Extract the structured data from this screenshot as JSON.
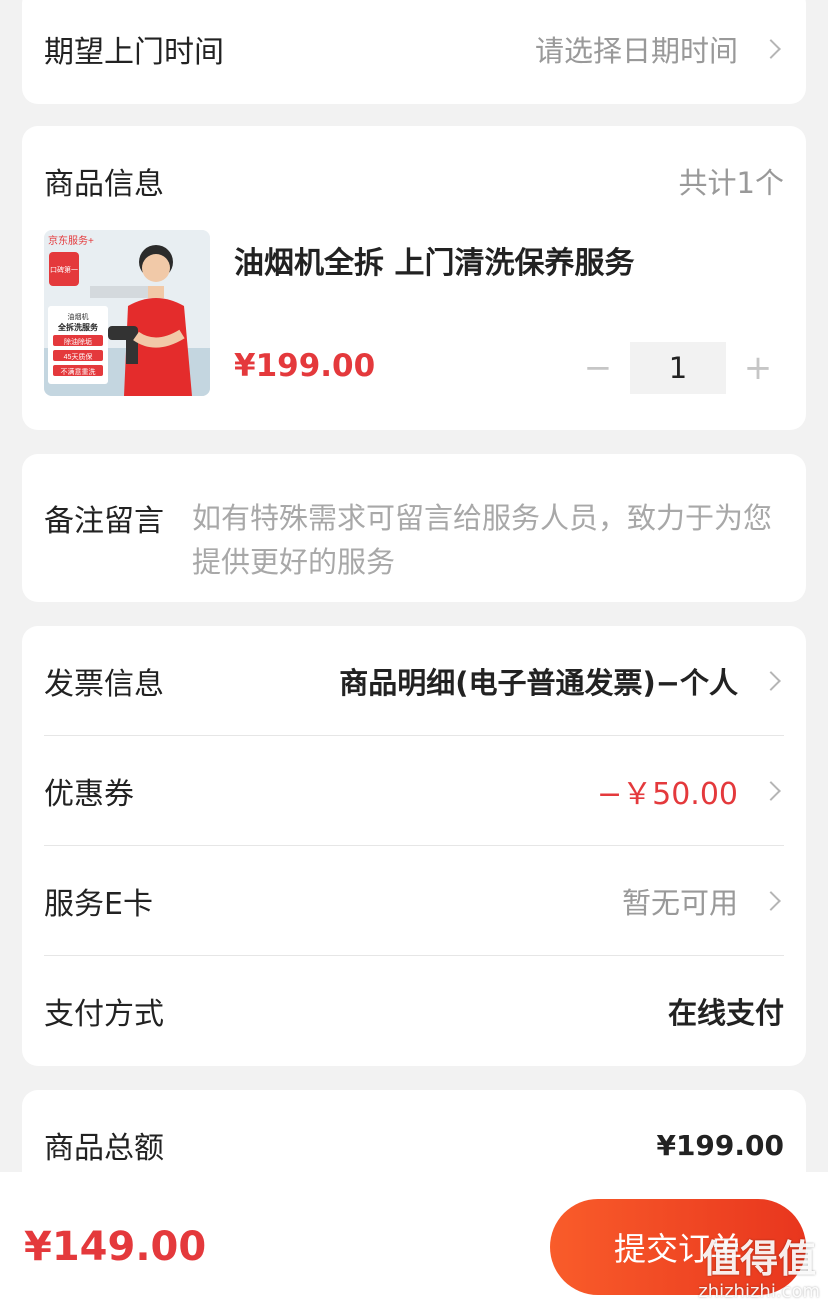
{
  "expected_time": {
    "label": "期望上门时间",
    "placeholder": "请选择日期时间"
  },
  "product_section": {
    "title": "商品信息",
    "count_text": "共计1个",
    "product": {
      "name": "油烟机全拆 上门清洗保养服务",
      "price": "¥199.00",
      "quantity": "1",
      "thumb": {
        "brand_text": "京东服务+",
        "badge_text": "口碑第一",
        "line1": "油烟机",
        "line2": "全拆洗服务",
        "tag1": "除油除垢",
        "tag2": "45天质保",
        "tag3": "不满意重洗"
      }
    },
    "minus_symbol": "−",
    "plus_symbol": "+"
  },
  "remark": {
    "label": "备注留言",
    "placeholder": "如有特殊需求可留言给服务人员，致力于为您提供更好的服务"
  },
  "options": {
    "invoice": {
      "label": "发票信息",
      "value": "商品明细(电子普通发票)−个人"
    },
    "coupon": {
      "label": "优惠券",
      "value": "−￥50.00"
    },
    "ecard": {
      "label": "服务E卡",
      "value": "暂无可用"
    },
    "payment": {
      "label": "支付方式",
      "value": "在线支付"
    }
  },
  "summary": {
    "label": "商品总额",
    "value": "¥199.00"
  },
  "bottom_bar": {
    "total": "¥149.00",
    "submit_label": "提交订单"
  },
  "watermark": {
    "big": "值得值",
    "small": "zhizhizhi.com"
  },
  "colors": {
    "accent_red": "#e4393c",
    "button_orange": "#f95c2a",
    "page_bg": "#f2f2f2"
  },
  "icons": {
    "chevron": "chevron-right-icon"
  }
}
